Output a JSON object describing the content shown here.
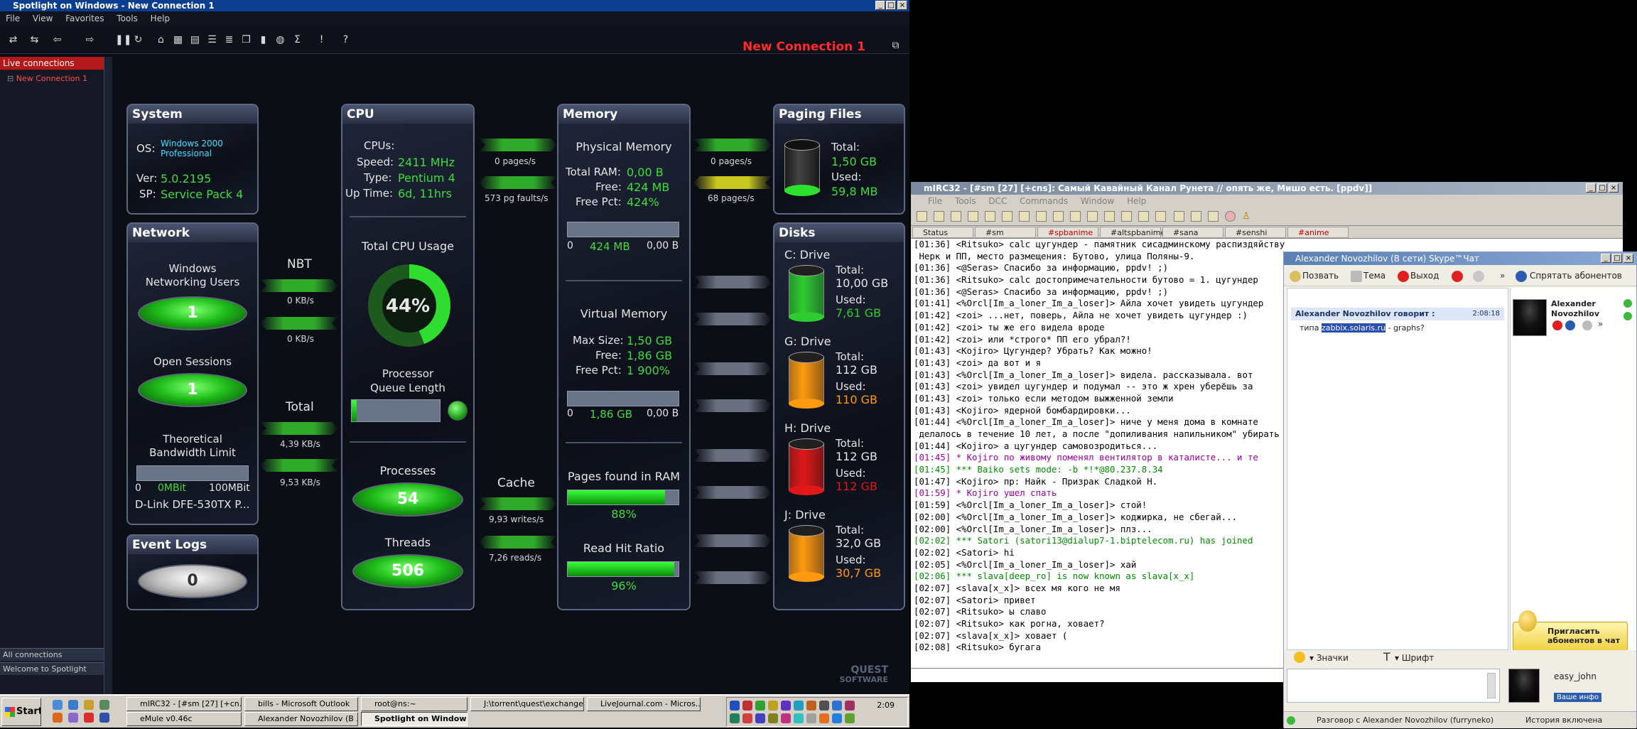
{
  "window": {
    "title": "Spotlight on Windows - New Connection 1",
    "connection_title": "New Connection 1"
  },
  "menu": [
    "File",
    "View",
    "Favorites",
    "Tools",
    "Help"
  ],
  "nav": {
    "header": "Live connections",
    "item": "New Connection 1",
    "bottom1": "All connections",
    "bottom2": "Welcome to Spotlight"
  },
  "system": {
    "title": "System",
    "os_label": "OS:",
    "os_value": "Windows 2000 Professional",
    "os_line1": "Windows 2000",
    "os_line2": "Professional",
    "ver_label": "Ver:",
    "ver_value": "5.0.2195",
    "sp_label": "SP:",
    "sp_value": "Service Pack 4"
  },
  "network": {
    "title": "Network",
    "wnu_label_1": "Windows",
    "wnu_label_2": "Networking Users",
    "wnu_value": "1",
    "sessions_label": "Open Sessions",
    "sessions_value": "1",
    "bw_label_1": "Theoretical",
    "bw_label_2": "Bandwidth Limit",
    "bw_min": "0",
    "bw_cur": "0MBit",
    "bw_max": "100MBit",
    "adapter": "D-Link DFE-530TX P..."
  },
  "event_logs": {
    "title": "Event Logs",
    "value": "0"
  },
  "nbt": {
    "label": "NBT",
    "in": "0 KB/s",
    "out": "0 KB/s"
  },
  "total": {
    "label": "Total",
    "in": "4,39 KB/s",
    "out": "9,53 KB/s"
  },
  "cpu": {
    "title": "CPU",
    "cpus_label": "CPUs:",
    "speed_label": "Speed:",
    "speed_value": "2411 MHz",
    "type_label": "Type:",
    "type_value": "Pentium 4",
    "uptime_label": "Up Time:",
    "uptime_value": "6d, 11hrs",
    "usage_label": "Total CPU Usage",
    "usage_value": "44%",
    "usage_pct": 44,
    "queue_label_1": "Processor",
    "queue_label_2": "Queue Length",
    "processes_label": "Processes",
    "processes_value": "54",
    "threads_label": "Threads",
    "threads_value": "506"
  },
  "cpu_mem_flows": {
    "pages": "0 pages/s",
    "faults": "573 pg faults/s"
  },
  "cache": {
    "label": "Cache",
    "writes": "9,93 writes/s",
    "reads": "7,26 reads/s"
  },
  "memory": {
    "title": "Memory",
    "phys_label": "Physical Memory",
    "total_label": "Total RAM:",
    "total_value": "0,00 B",
    "free_label": "Free:",
    "free_value": "424 MB",
    "freepct_label": "Free Pct:",
    "freepct_value": "424%",
    "bar1_min": "0",
    "bar1_cur": "424 MB",
    "bar1_max": "0,00 B",
    "virt_label": "Virtual Memory",
    "max_label": "Max Size:",
    "max_value": "1,50 GB",
    "vfree_label": "Free:",
    "vfree_value": "1,86 GB",
    "vfreepct_label": "Free Pct:",
    "vfreepct_value": "1 900%",
    "bar2_min": "0",
    "bar2_cur": "1,86 GB",
    "bar2_max": "0,00 B",
    "pages_label": "Pages found in RAM",
    "pages_value": "88%",
    "pages_pct": 88,
    "hit_label": "Read Hit Ratio",
    "hit_value": "96%",
    "hit_pct": 96
  },
  "mem_paging_flows": {
    "pages_out": "0 pages/s",
    "pages_in": "68 pages/s"
  },
  "paging": {
    "title": "Paging Files",
    "total_label": "Total:",
    "total_value": "1,50 GB",
    "used_label": "Used:",
    "used_value": "59,8 MB"
  },
  "disks": {
    "title": "Disks",
    "items": [
      {
        "name": "C: Drive",
        "total_label": "Total:",
        "total": "10,00 GB",
        "used_label": "Used:",
        "used": "7,61 GB",
        "color": "#2ecc2e"
      },
      {
        "name": "G: Drive",
        "total_label": "Total:",
        "total": "112 GB",
        "used_label": "Used:",
        "used": "110 GB",
        "color": "#ff9a10"
      },
      {
        "name": "H: Drive",
        "total_label": "Total:",
        "total": "112 GB",
        "used_label": "Used:",
        "used": "112 GB",
        "color": "#e01818"
      },
      {
        "name": "J: Drive",
        "total_label": "Total:",
        "total": "32,0 GB",
        "used_label": "Used:",
        "used": "30,7 GB",
        "color": "#ff9a10"
      }
    ]
  },
  "brand": {
    "line1": "QUEST",
    "line2": "SOFTWARE"
  },
  "mirc": {
    "title": "mIRC32 - [#sm [27] [+cns]: Самый Кавайный Канал Рунета // опять же, Мишо есть. [ppdv]]",
    "menu": [
      "File",
      "Tools",
      "DCC",
      "Commands",
      "Window",
      "Help"
    ],
    "tabs": [
      "Status",
      "#sm",
      "#spbanime",
      "#altspbanime",
      "#sana",
      "#senshi",
      "#anime"
    ],
    "lines": [
      {
        "text": "[01:36] <Ritsuko> calc цугундер - памятник сисадминскому распиздяйству",
        "c": ""
      },
      {
        "text": " Нерк и ПП, место размещения: Бутово, улица Поляны-9.",
        "c": ""
      },
      {
        "text": "[01:36] <@Seras> Спасибо за информацию, ppdv! ;)",
        "c": ""
      },
      {
        "text": "[01:36] <Ritsuko> calc достопримечательности бутово = 1. цугундер",
        "c": ""
      },
      {
        "text": "[01:36] <@Seras> Спасибо за информацию, ppdv! ;)",
        "c": ""
      },
      {
        "text": "[01:41] <%Orcl[Im_a_loner_Im_a_loser]> Айла хочет увидеть цугундер",
        "c": ""
      },
      {
        "text": "[01:42] <zoi> ...нет, поверь, Айла не хочет увидеть цугундер :)",
        "c": ""
      },
      {
        "text": "[01:42] <zoi> ты же его видела вроде",
        "c": ""
      },
      {
        "text": "[01:42] <zoi> или *строго* ПП его убрал?!",
        "c": ""
      },
      {
        "text": "[01:43] <Kojiro> Цугундер? Убрать? Как можно!",
        "c": ""
      },
      {
        "text": "[01:43] <zoi> да вот и я",
        "c": ""
      },
      {
        "text": "[01:43] <%Orcl[Im_a_loner_Im_a_loser]> видела. рассказывала. вот",
        "c": ""
      },
      {
        "text": "[01:43] <zoi> увидел цугундер и подумал -- это ж хрен уберёшь за",
        "c": ""
      },
      {
        "text": "[01:43] <zoi> только если методом выжженной земли",
        "c": ""
      },
      {
        "text": "[01:43] <Kojiro> ядерной бомбардировки...",
        "c": ""
      },
      {
        "text": "[01:44] <%Orcl[Im_a_loner_Im_a_loser]> ниче у меня дома в комнате",
        "c": ""
      },
      {
        "text": " делалось в течение 10 лет, а после \"допиливания напильником\" убирать",
        "c": ""
      },
      {
        "text": "[01:44] <Kojiro> а цугундер самовозродиться...",
        "c": ""
      },
      {
        "text": "[01:45] * Kojiro по живому поменял вентилятор в каталисте... и те",
        "c": "pu"
      },
      {
        "text": "[01:45] *** Baiko sets mode: -b *!*@80.237.8.34",
        "c": "gn"
      },
      {
        "text": "[01:47] <Kojiro> пр: Найк - Призрак Сладкой Н.",
        "c": ""
      },
      {
        "text": "[01:59] * Kojiro ушел спать",
        "c": "pu"
      },
      {
        "text": "[01:59] <%Orcl[Im_a_loner_Im_a_loser]> стой!",
        "c": ""
      },
      {
        "text": "[02:00] <%Orcl[Im_a_loner_Im_a_loser]> коджирка, не сбегай...",
        "c": ""
      },
      {
        "text": "[02:00] <%Orcl[Im_a_loner_Im_a_loser]> плз...",
        "c": ""
      },
      {
        "text": "[02:02] *** Satori (satori13@dialup7-1.biptelecom.ru) has joined",
        "c": "gn"
      },
      {
        "text": "[02:02] <Satori> hi",
        "c": ""
      },
      {
        "text": "[02:05] <%Orcl[Im_a_loner_Im_a_loser]> хай",
        "c": ""
      },
      {
        "text": "[02:06] *** slava[deep_ro] is now known as slava[x_x]",
        "c": "gn"
      },
      {
        "text": "[02:07] <slava[x_x]> всех мя кого не мя",
        "c": ""
      },
      {
        "text": "[02:07] <Satori> привет",
        "c": ""
      },
      {
        "text": "[02:07] <Ritsuko> ы славо",
        "c": ""
      },
      {
        "text": "[02:07] <Ritsuko> как рогна, ховает?",
        "c": ""
      },
      {
        "text": "[02:07] <slava[x_x]> ховает (",
        "c": ""
      },
      {
        "text": "[02:08] <Ritsuko> бугага",
        "c": ""
      }
    ]
  },
  "skype": {
    "title": "Alexander Novozhilov (В сети) Skype™Чат",
    "toolbar": {
      "call": "Позвать",
      "topic": "Тема",
      "exit": "Выход",
      "hide": "Спрятать абонентов"
    },
    "msg_author": "Alexander Novozhilov говорит :",
    "msg_time": "2:08:18",
    "msg_prefix": "типа",
    "msg_link": "zabbix.solaris.ru",
    "msg_suffix": "- graphs?",
    "contact_1": "Alexander",
    "contact_2": "Novozhilov",
    "invite": "Пригласить абонентов в чат",
    "emoticons": "Значки",
    "font": "Шрифт",
    "self_name": "easy_john",
    "self_info": "Ваше инфо",
    "status_text": "Разговор с Alexander Novozhilov (furryneko)",
    "history": "История включена"
  },
  "taskbar": {
    "start": "Start",
    "buttons": [
      "mIRC32 - [#sm [27] [+cn...",
      "eMule v0.46c",
      "bills - Microsoft Outlook",
      "Alexander Novozhilov (В ...",
      "root@ns:~",
      "Spotlight on Windows ...",
      "J:\\torrent\\quest\\exchange",
      "LiveJournal.com - Micros..."
    ],
    "clock": "2:09"
  }
}
